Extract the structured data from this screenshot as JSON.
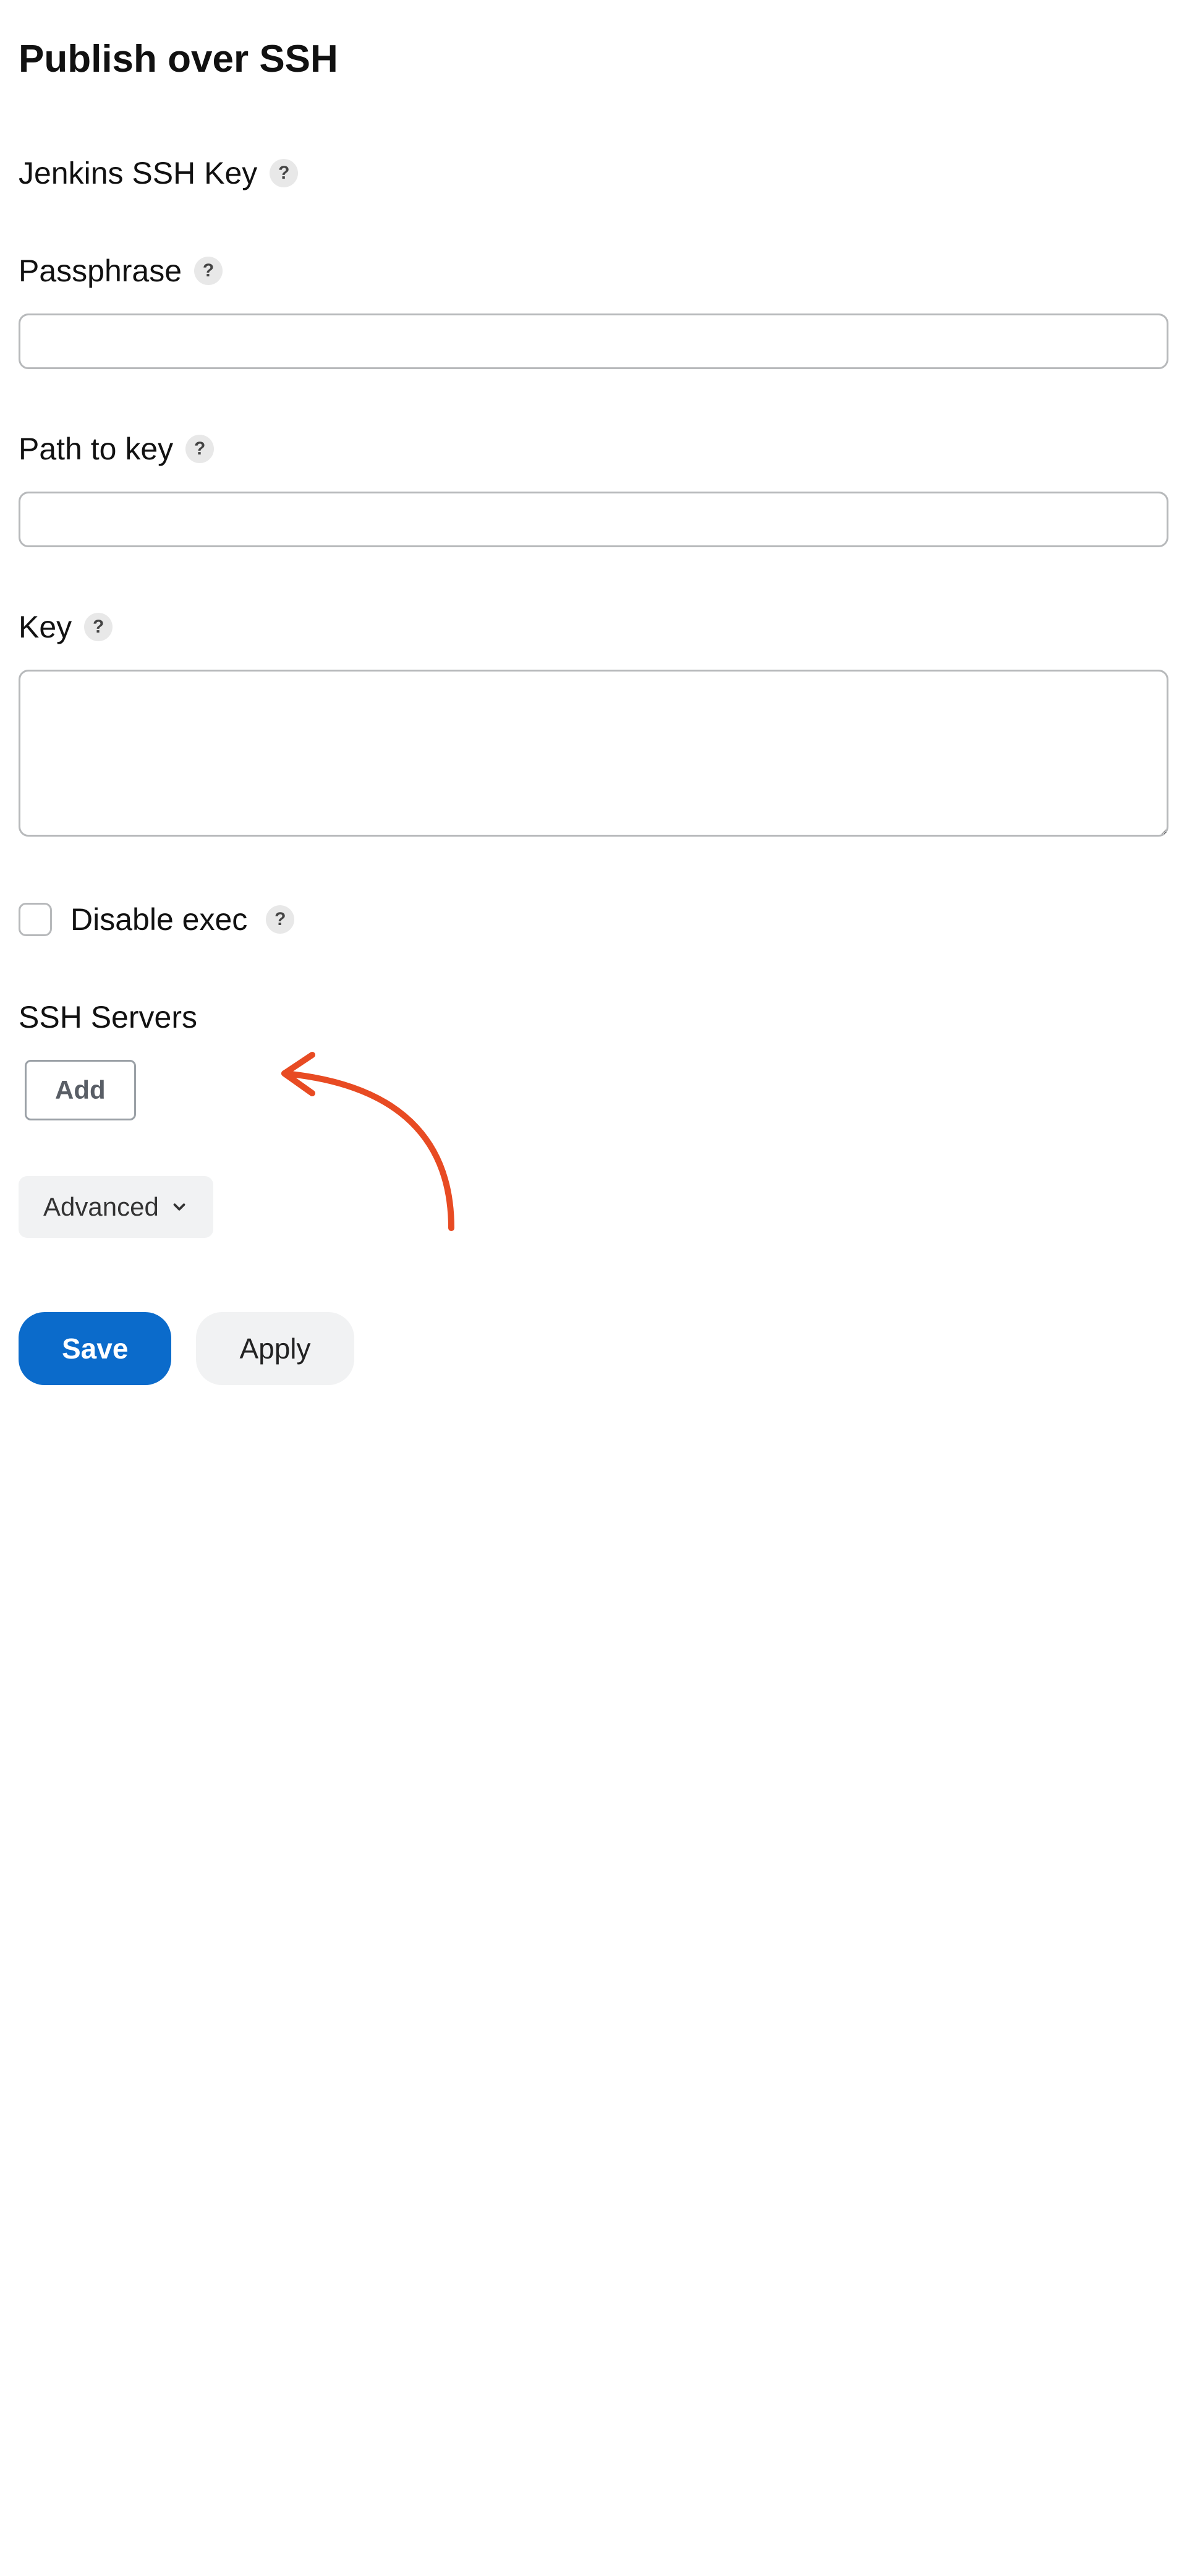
{
  "title": "Publish over SSH",
  "jenkins_key_heading": "Jenkins SSH Key",
  "passphrase": {
    "label": "Passphrase",
    "value": ""
  },
  "path_to_key": {
    "label": "Path to key",
    "value": ""
  },
  "key": {
    "label": "Key",
    "value": ""
  },
  "disable_exec": {
    "label": "Disable exec",
    "checked": false
  },
  "ssh_servers": {
    "label": "SSH Servers",
    "add_label": "Add",
    "advanced_label": "Advanced"
  },
  "buttons": {
    "save": "Save",
    "apply": "Apply"
  },
  "help_icon": "?"
}
